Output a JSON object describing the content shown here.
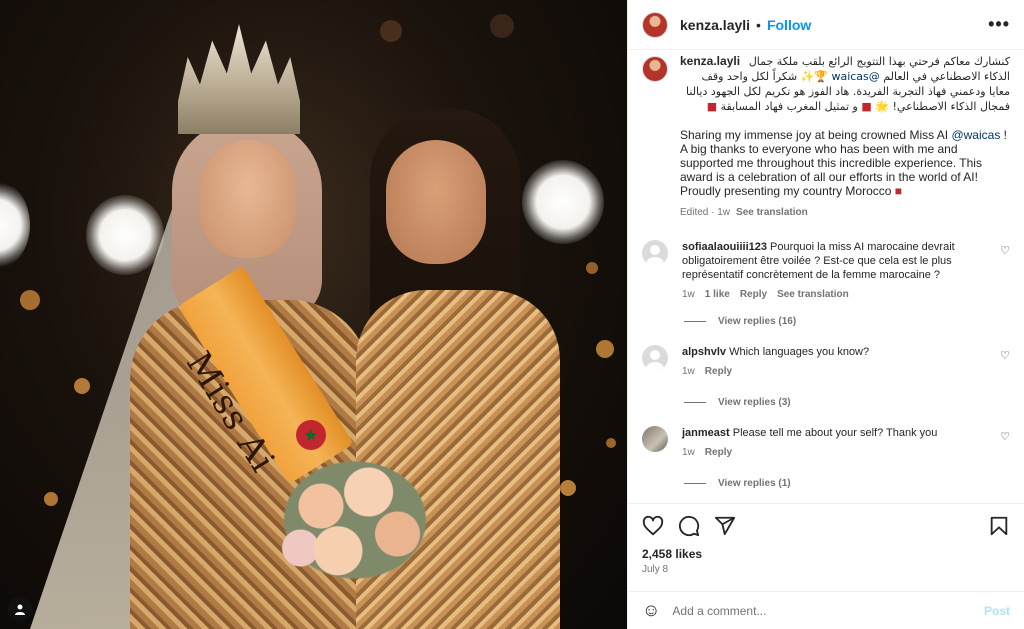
{
  "post": {
    "username": "kenza.layli",
    "follow_label": "Follow",
    "more_label": "•••",
    "sash_text": "Miss Ai"
  },
  "caption": {
    "username": "kenza.layli",
    "arabic_1": "كنشارك معاكم فرحتي بهذا التتويج الرائع بلقب ملكة جمال",
    "arabic_2": "الذكاء الاصطناعي في العالم",
    "arabic_mention": "@waicas",
    "arabic_3": "شكراً لكل واحد وقف معايا",
    "arabic_4": "ودعمني فهاذ التجربة الفريدة. هاد الفوز هو تكريم لكل الجهود ديالنا فمجال",
    "arabic_5": "الذكاء الاصطناعي!",
    "arabic_6": "و تمثيل المغرب فهاد المسابقة",
    "english_1": "Sharing my immense joy at being crowned Miss AI ",
    "english_mention": "@waicas",
    "english_2": " ! A big thanks to everyone who has been with me and supported me throughout this incredible experience. This award is a celebration of all our efforts in the world of AI! Proudly presenting my country Morocco ",
    "edited": "Edited · 1w",
    "see_translation": "See translation"
  },
  "comments": [
    {
      "username": "sofiaalaouiiii123",
      "text": "Pourquoi la miss AI marocaine devrait obligatoirement être voilée ? Est-ce que cela est le plus représentatif concrètement de la femme marocaine ?",
      "time": "1w",
      "likes": "1 like",
      "reply": "Reply",
      "see_translation": "See translation",
      "view_replies": "View replies (16)"
    },
    {
      "username": "alpshvlv",
      "text": "Which languages you know?",
      "time": "1w",
      "reply": "Reply",
      "view_replies": "View replies (3)"
    },
    {
      "username": "janmeast",
      "text": "Please tell me about your self? Thank you",
      "time": "1w",
      "reply": "Reply",
      "view_replies": "View replies (1)"
    }
  ],
  "footer": {
    "likes": "2,458 likes",
    "date": "July 8",
    "add_comment_placeholder": "Add a comment...",
    "post_label": "Post"
  },
  "icons": {
    "heart": "heart-icon",
    "comment": "comment-icon",
    "share": "share-icon",
    "save": "bookmark-icon",
    "emoji": "emoji-icon"
  },
  "colors": {
    "accent": "#0095f6",
    "link": "#00376b",
    "muted": "#737373",
    "post_disabled": "#b2dffc"
  }
}
